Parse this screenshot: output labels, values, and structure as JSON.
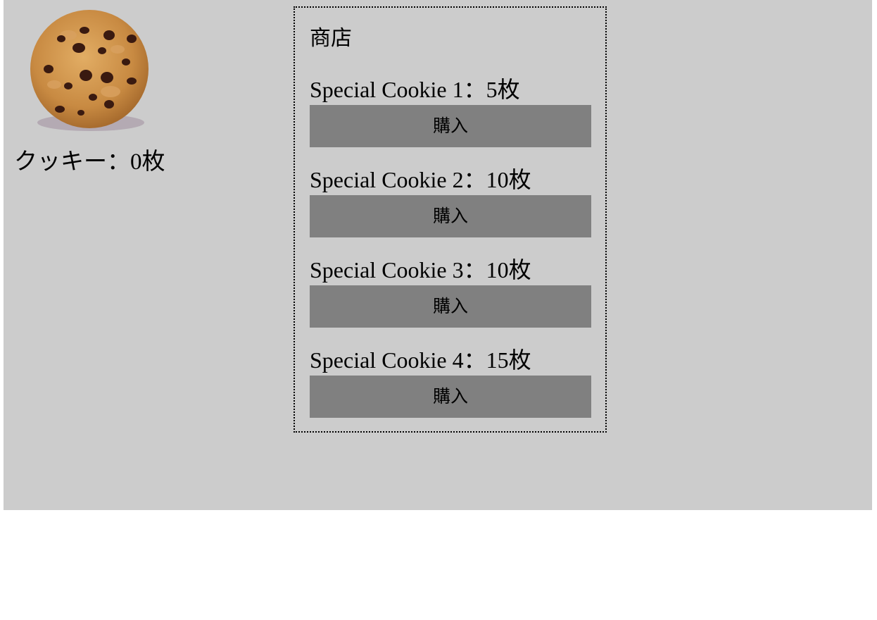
{
  "cookie": {
    "icon": "cookie-icon",
    "count_label": "クッキー：0枚"
  },
  "shop": {
    "title": "商店",
    "items": [
      {
        "label": "Special Cookie 1：5枚",
        "buy_label": "購入"
      },
      {
        "label": "Special Cookie 2：10枚",
        "buy_label": "購入"
      },
      {
        "label": "Special Cookie 3：10枚",
        "buy_label": "購入"
      },
      {
        "label": "Special Cookie 4：15枚",
        "buy_label": "購入"
      }
    ]
  },
  "colors": {
    "background": "#cccccc",
    "button": "#808080"
  }
}
